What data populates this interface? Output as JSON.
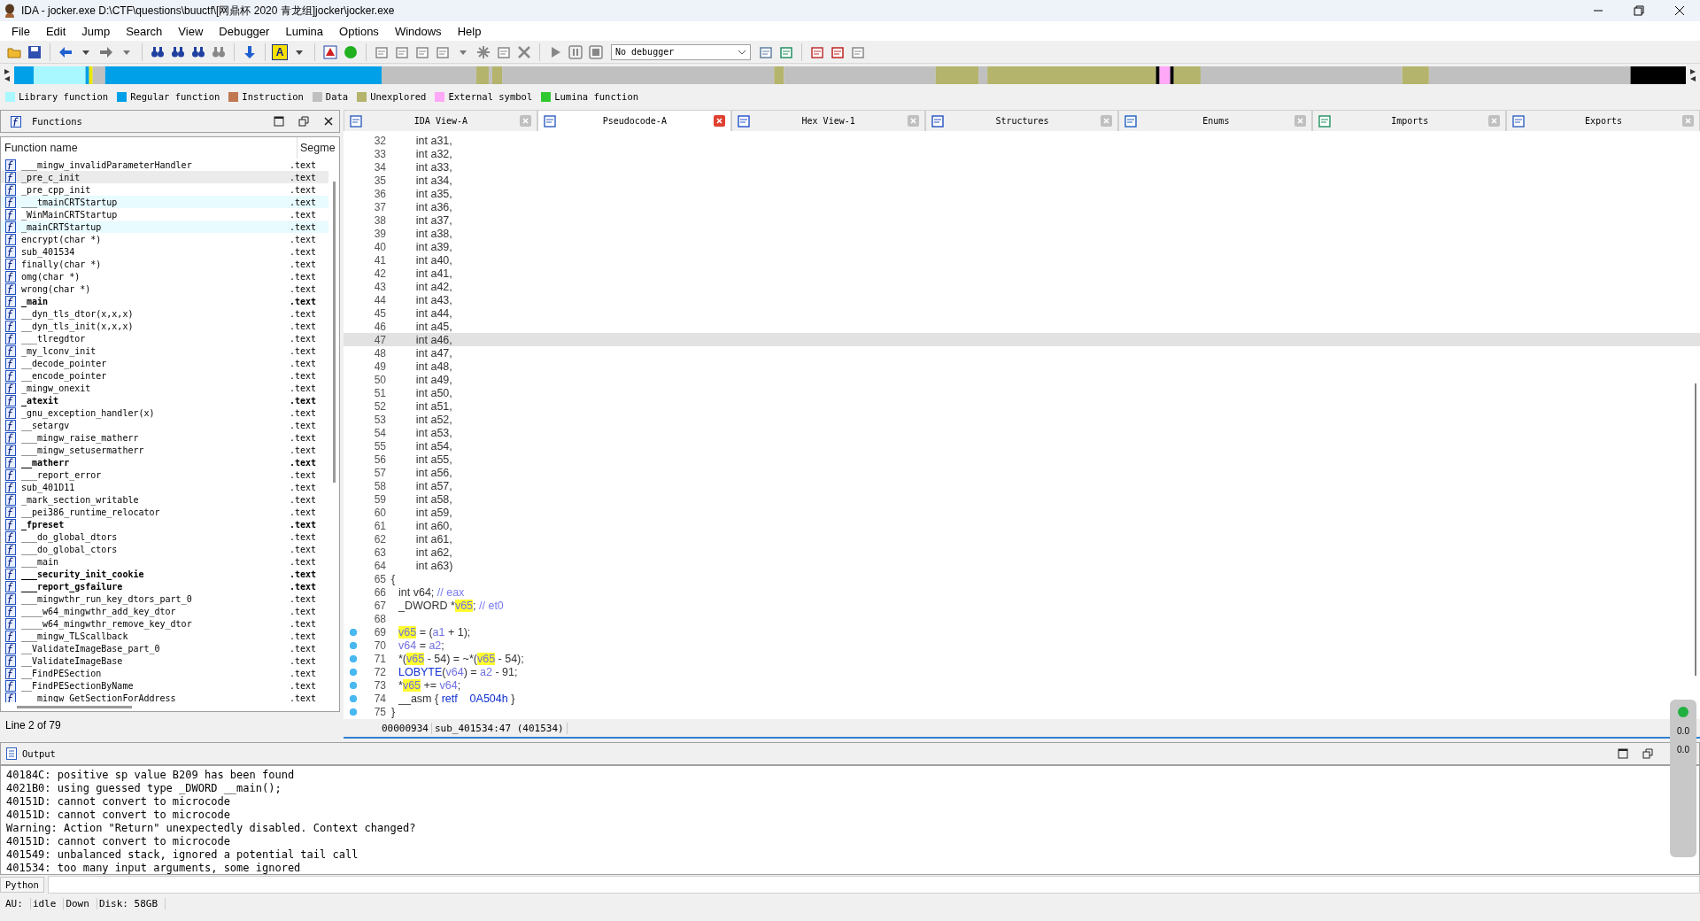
{
  "window": {
    "title": "IDA - jocker.exe D:\\CTF\\questions\\buuctf\\[网鼎杯 2020 青龙组]jocker\\jocker.exe"
  },
  "menu": [
    "File",
    "Edit",
    "Jump",
    "Search",
    "View",
    "Debugger",
    "Lumina",
    "Options",
    "Windows",
    "Help"
  ],
  "toolbar": {
    "font_button": "A",
    "debugger": "No debugger"
  },
  "legend": [
    {
      "label": "Library function",
      "color": "#aaf8ff"
    },
    {
      "label": "Regular function",
      "color": "#00a0e8"
    },
    {
      "label": "Instruction",
      "color": "#c07850"
    },
    {
      "label": "Data",
      "color": "#c0c0c0"
    },
    {
      "label": "Unexplored",
      "color": "#b4b46c"
    },
    {
      "label": "External symbol",
      "color": "#ffa8f8"
    },
    {
      "label": "Lumina function",
      "color": "#30c830"
    }
  ],
  "functions": {
    "title": "Functions",
    "columns": [
      "Function name",
      "Segme"
    ],
    "status": "Line 2 of 79",
    "rows": [
      {
        "name": "___mingw_invalidParameterHandler",
        "segment": ".text",
        "bold": false,
        "selected": false,
        "library": false
      },
      {
        "name": "_pre_c_init",
        "segment": ".text",
        "bold": false,
        "selected": true,
        "library": false
      },
      {
        "name": "_pre_cpp_init",
        "segment": ".text",
        "bold": false,
        "selected": false,
        "library": false
      },
      {
        "name": "___tmainCRTStartup",
        "segment": ".text",
        "bold": false,
        "selected": false,
        "library": true
      },
      {
        "name": "_WinMainCRTStartup",
        "segment": ".text",
        "bold": false,
        "selected": false,
        "library": false
      },
      {
        "name": "_mainCRTStartup",
        "segment": ".text",
        "bold": false,
        "selected": false,
        "library": true
      },
      {
        "name": "encrypt(char *)",
        "segment": ".text",
        "bold": false,
        "selected": false,
        "library": false
      },
      {
        "name": "sub_401534",
        "segment": ".text",
        "bold": false,
        "selected": false,
        "library": false
      },
      {
        "name": "finally(char *)",
        "segment": ".text",
        "bold": false,
        "selected": false,
        "library": false
      },
      {
        "name": "omg(char *)",
        "segment": ".text",
        "bold": false,
        "selected": false,
        "library": false
      },
      {
        "name": "wrong(char *)",
        "segment": ".text",
        "bold": false,
        "selected": false,
        "library": false
      },
      {
        "name": "_main",
        "segment": ".text",
        "bold": true,
        "selected": false,
        "library": false
      },
      {
        "name": "__dyn_tls_dtor(x,x,x)",
        "segment": ".text",
        "bold": false,
        "selected": false,
        "library": false
      },
      {
        "name": "__dyn_tls_init(x,x,x)",
        "segment": ".text",
        "bold": false,
        "selected": false,
        "library": false
      },
      {
        "name": "___tlregdtor",
        "segment": ".text",
        "bold": false,
        "selected": false,
        "library": false
      },
      {
        "name": "_my_lconv_init",
        "segment": ".text",
        "bold": false,
        "selected": false,
        "library": false
      },
      {
        "name": "__decode_pointer",
        "segment": ".text",
        "bold": false,
        "selected": false,
        "library": false
      },
      {
        "name": "__encode_pointer",
        "segment": ".text",
        "bold": false,
        "selected": false,
        "library": false
      },
      {
        "name": "_mingw_onexit",
        "segment": ".text",
        "bold": false,
        "selected": false,
        "library": false
      },
      {
        "name": "_atexit",
        "segment": ".text",
        "bold": true,
        "selected": false,
        "library": false
      },
      {
        "name": "_gnu_exception_handler(x)",
        "segment": ".text",
        "bold": false,
        "selected": false,
        "library": false
      },
      {
        "name": "__setargv",
        "segment": ".text",
        "bold": false,
        "selected": false,
        "library": false
      },
      {
        "name": "___mingw_raise_matherr",
        "segment": ".text",
        "bold": false,
        "selected": false,
        "library": false
      },
      {
        "name": "___mingw_setusermatherr",
        "segment": ".text",
        "bold": false,
        "selected": false,
        "library": false
      },
      {
        "name": "__matherr",
        "segment": ".text",
        "bold": true,
        "selected": false,
        "library": false
      },
      {
        "name": "___report_error",
        "segment": ".text",
        "bold": false,
        "selected": false,
        "library": false
      },
      {
        "name": "sub_401D11",
        "segment": ".text",
        "bold": false,
        "selected": false,
        "library": false
      },
      {
        "name": "_mark_section_writable",
        "segment": ".text",
        "bold": false,
        "selected": false,
        "library": false
      },
      {
        "name": "__pei386_runtime_relocator",
        "segment": ".text",
        "bold": false,
        "selected": false,
        "library": false
      },
      {
        "name": "_fpreset",
        "segment": ".text",
        "bold": true,
        "selected": false,
        "library": false
      },
      {
        "name": "___do_global_dtors",
        "segment": ".text",
        "bold": false,
        "selected": false,
        "library": false
      },
      {
        "name": "___do_global_ctors",
        "segment": ".text",
        "bold": false,
        "selected": false,
        "library": false
      },
      {
        "name": "___main",
        "segment": ".text",
        "bold": false,
        "selected": false,
        "library": false
      },
      {
        "name": "___security_init_cookie",
        "segment": ".text",
        "bold": true,
        "selected": false,
        "library": false
      },
      {
        "name": "___report_gsfailure",
        "segment": ".text",
        "bold": true,
        "selected": false,
        "library": false
      },
      {
        "name": "___mingwthr_run_key_dtors_part_0",
        "segment": ".text",
        "bold": false,
        "selected": false,
        "library": false
      },
      {
        "name": "____w64_mingwthr_add_key_dtor",
        "segment": ".text",
        "bold": false,
        "selected": false,
        "library": false
      },
      {
        "name": "____w64_mingwthr_remove_key_dtor",
        "segment": ".text",
        "bold": false,
        "selected": false,
        "library": false
      },
      {
        "name": "___mingw_TLScallback",
        "segment": ".text",
        "bold": false,
        "selected": false,
        "library": false
      },
      {
        "name": "__ValidateImageBase_part_0",
        "segment": ".text",
        "bold": false,
        "selected": false,
        "library": false
      },
      {
        "name": "__ValidateImageBase",
        "segment": ".text",
        "bold": false,
        "selected": false,
        "library": false
      },
      {
        "name": "__FindPESection",
        "segment": ".text",
        "bold": false,
        "selected": false,
        "library": false
      },
      {
        "name": "__FindPESectionByName",
        "segment": ".text",
        "bold": false,
        "selected": false,
        "library": false
      },
      {
        "name": "___mingw_GetSectionForAddress",
        "segment": ".text",
        "bold": false,
        "selected": false,
        "library": false
      }
    ]
  },
  "tabs": [
    {
      "label": "IDA View-A",
      "selected": false
    },
    {
      "label": "Pseudocode-A",
      "selected": true
    },
    {
      "label": "Hex View-1",
      "selected": false
    },
    {
      "label": "Structures",
      "selected": false
    },
    {
      "label": "Enums",
      "selected": false
    },
    {
      "label": "Imports",
      "selected": false
    },
    {
      "label": "Exports",
      "selected": false
    }
  ],
  "code": {
    "status": [
      "00000934",
      "sub_401534:47 (401534)"
    ],
    "lines": [
      {
        "number": "32",
        "dot": false,
        "selected": false,
        "block": false,
        "segments": [
          {
            "text": "        int a31,",
            "kind": "decl"
          }
        ]
      },
      {
        "number": "33",
        "dot": false,
        "selected": false,
        "block": false,
        "segments": [
          {
            "text": "        int a32,",
            "kind": "decl"
          }
        ]
      },
      {
        "number": "34",
        "dot": false,
        "selected": false,
        "block": false,
        "segments": [
          {
            "text": "        int a33,",
            "kind": "decl"
          }
        ]
      },
      {
        "number": "35",
        "dot": false,
        "selected": false,
        "block": false,
        "segments": [
          {
            "text": "        int a34,",
            "kind": "decl"
          }
        ]
      },
      {
        "number": "36",
        "dot": false,
        "selected": false,
        "block": false,
        "segments": [
          {
            "text": "        int a35,",
            "kind": "decl"
          }
        ]
      },
      {
        "number": "37",
        "dot": false,
        "selected": false,
        "block": false,
        "segments": [
          {
            "text": "        int a36,",
            "kind": "decl"
          }
        ]
      },
      {
        "number": "38",
        "dot": false,
        "selected": false,
        "block": false,
        "segments": [
          {
            "text": "        int a37,",
            "kind": "decl"
          }
        ]
      },
      {
        "number": "39",
        "dot": false,
        "selected": false,
        "block": false,
        "segments": [
          {
            "text": "        int a38,",
            "kind": "decl"
          }
        ]
      },
      {
        "number": "40",
        "dot": false,
        "selected": false,
        "block": false,
        "segments": [
          {
            "text": "        int a39,",
            "kind": "decl"
          }
        ]
      },
      {
        "number": "41",
        "dot": false,
        "selected": false,
        "block": false,
        "segments": [
          {
            "text": "        int a40,",
            "kind": "decl"
          }
        ]
      },
      {
        "number": "42",
        "dot": false,
        "selected": false,
        "block": false,
        "segments": [
          {
            "text": "        int a41,",
            "kind": "decl"
          }
        ]
      },
      {
        "number": "43",
        "dot": false,
        "selected": false,
        "block": false,
        "segments": [
          {
            "text": "        int a42,",
            "kind": "decl"
          }
        ]
      },
      {
        "number": "44",
        "dot": false,
        "selected": false,
        "block": false,
        "segments": [
          {
            "text": "        int a43,",
            "kind": "decl"
          }
        ]
      },
      {
        "number": "45",
        "dot": false,
        "selected": false,
        "block": false,
        "segments": [
          {
            "text": "        int a44,",
            "kind": "decl"
          }
        ]
      },
      {
        "number": "46",
        "dot": false,
        "selected": false,
        "block": false,
        "segments": [
          {
            "text": "        int a45,",
            "kind": "decl"
          }
        ]
      },
      {
        "number": "47",
        "dot": false,
        "selected": true,
        "block": false,
        "segments": [
          {
            "text": "        int a46,",
            "kind": "decl"
          }
        ]
      },
      {
        "number": "48",
        "dot": false,
        "selected": false,
        "block": false,
        "segments": [
          {
            "text": "        int a47,",
            "kind": "decl"
          }
        ]
      },
      {
        "number": "49",
        "dot": false,
        "selected": false,
        "block": false,
        "segments": [
          {
            "text": "        int a48,",
            "kind": "decl"
          }
        ]
      },
      {
        "number": "50",
        "dot": false,
        "selected": false,
        "block": false,
        "segments": [
          {
            "text": "        int a49,",
            "kind": "decl"
          }
        ]
      },
      {
        "number": "51",
        "dot": false,
        "selected": false,
        "block": false,
        "segments": [
          {
            "text": "        int a50,",
            "kind": "decl"
          }
        ]
      },
      {
        "number": "52",
        "dot": false,
        "selected": false,
        "block": false,
        "segments": [
          {
            "text": "        int a51,",
            "kind": "decl"
          }
        ]
      },
      {
        "number": "53",
        "dot": false,
        "selected": false,
        "block": false,
        "segments": [
          {
            "text": "        int a52,",
            "kind": "decl"
          }
        ]
      },
      {
        "number": "54",
        "dot": false,
        "selected": false,
        "block": false,
        "segments": [
          {
            "text": "        int a53,",
            "kind": "decl"
          }
        ]
      },
      {
        "number": "55",
        "dot": false,
        "selected": false,
        "block": false,
        "segments": [
          {
            "text": "        int a54,",
            "kind": "decl"
          }
        ]
      },
      {
        "number": "56",
        "dot": false,
        "selected": false,
        "block": false,
        "segments": [
          {
            "text": "        int a55,",
            "kind": "decl"
          }
        ]
      },
      {
        "number": "57",
        "dot": false,
        "selected": false,
        "block": false,
        "segments": [
          {
            "text": "        int a56,",
            "kind": "decl"
          }
        ]
      },
      {
        "number": "58",
        "dot": false,
        "selected": false,
        "block": false,
        "segments": [
          {
            "text": "        int a57,",
            "kind": "decl"
          }
        ]
      },
      {
        "number": "59",
        "dot": false,
        "selected": false,
        "block": false,
        "segments": [
          {
            "text": "        int a58,",
            "kind": "decl"
          }
        ]
      },
      {
        "number": "60",
        "dot": false,
        "selected": false,
        "block": false,
        "segments": [
          {
            "text": "        int a59,",
            "kind": "decl"
          }
        ]
      },
      {
        "number": "61",
        "dot": false,
        "selected": false,
        "block": false,
        "segments": [
          {
            "text": "        int a60,",
            "kind": "decl"
          }
        ]
      },
      {
        "number": "62",
        "dot": false,
        "selected": false,
        "block": false,
        "segments": [
          {
            "text": "        int a61,",
            "kind": "decl"
          }
        ]
      },
      {
        "number": "63",
        "dot": false,
        "selected": false,
        "block": false,
        "segments": [
          {
            "text": "        int a62,",
            "kind": "decl"
          }
        ]
      },
      {
        "number": "64",
        "dot": false,
        "selected": false,
        "block": false,
        "segments": [
          {
            "text": "        int a63)",
            "kind": "decl"
          }
        ]
      },
      {
        "number": "65",
        "dot": false,
        "selected": false,
        "block": false,
        "segments": [
          {
            "text": "{",
            "kind": "decl"
          }
        ]
      },
      {
        "number": "66",
        "dot": false,
        "selected": false,
        "block": true,
        "segments": [
          {
            "text": "int v64; ",
            "kind": "decl"
          },
          {
            "text": "// eax",
            "kind": "comment"
          }
        ]
      },
      {
        "number": "67",
        "dot": false,
        "selected": false,
        "block": true,
        "segments": [
          {
            "text": "_DWORD *",
            "kind": "decl"
          },
          {
            "text": "v65",
            "kind": "highlight"
          },
          {
            "text": "; ",
            "kind": "decl"
          },
          {
            "text": "// et0",
            "kind": "comment"
          }
        ]
      },
      {
        "number": "68",
        "dot": false,
        "selected": false
      },
      {
        "number": "69",
        "dot": true,
        "selected": false,
        "block": true,
        "segments": [
          {
            "text": "v65",
            "kind": "highlight"
          },
          {
            "text": " = (",
            "kind": "decl"
          },
          {
            "text": "a1",
            "kind": "var"
          },
          {
            "text": " + 1);",
            "kind": "decl"
          }
        ]
      },
      {
        "number": "70",
        "dot": true,
        "selected": false,
        "block": true,
        "segments": [
          {
            "text": "v64",
            "kind": "var"
          },
          {
            "text": " = ",
            "kind": "decl"
          },
          {
            "text": "a2",
            "kind": "var"
          },
          {
            "text": ";",
            "kind": "decl"
          }
        ]
      },
      {
        "number": "71",
        "dot": true,
        "selected": false,
        "block": true,
        "segments": [
          {
            "text": "*(",
            "kind": "decl"
          },
          {
            "text": "v65",
            "kind": "highlight"
          },
          {
            "text": " - 54) = ~*(",
            "kind": "decl"
          },
          {
            "text": "v65",
            "kind": "highlight"
          },
          {
            "text": " - 54);",
            "kind": "decl"
          }
        ]
      },
      {
        "number": "72",
        "dot": true,
        "selected": false,
        "block": true,
        "segments": [
          {
            "text": "LOBYTE",
            "kind": "macro"
          },
          {
            "text": "(",
            "kind": "decl"
          },
          {
            "text": "v64",
            "kind": "var"
          },
          {
            "text": ") = ",
            "kind": "decl"
          },
          {
            "text": "a2",
            "kind": "var"
          },
          {
            "text": " - 91;",
            "kind": "decl"
          }
        ]
      },
      {
        "number": "73",
        "dot": true,
        "selected": false,
        "block": true,
        "segments": [
          {
            "text": "*",
            "kind": "decl"
          },
          {
            "text": "v65",
            "kind": "highlight"
          },
          {
            "text": " += ",
            "kind": "decl"
          },
          {
            "text": "v64",
            "kind": "var"
          },
          {
            "text": ";",
            "kind": "decl"
          }
        ]
      },
      {
        "number": "74",
        "dot": true,
        "selected": false,
        "block": true,
        "segments": [
          {
            "text": "__asm { ",
            "kind": "decl"
          },
          {
            "text": "retf    0A504h",
            "kind": "macro"
          },
          {
            "text": " }",
            "kind": "decl"
          }
        ]
      },
      {
        "number": "75",
        "dot": true,
        "selected": false,
        "block": false,
        "segments": [
          {
            "text": "}",
            "kind": "decl"
          }
        ]
      }
    ]
  },
  "output": {
    "title": "Output",
    "input_tab": "Python",
    "lines": [
      "40184C: positive sp value B209 has been found",
      "4021B0: using guessed type _DWORD __main();",
      "40151D: cannot convert to microcode",
      "40151D: cannot convert to microcode",
      "Warning: Action \"Return\" unexpectedly disabled. Context changed?",
      "40151D: cannot convert to microcode",
      "401549: unbalanced stack, ignored a potential tail call",
      "401534: too many input arguments, some ignored"
    ]
  },
  "status_bar": [
    "AU:",
    "idle",
    "Down",
    "Disk: 58GB"
  ],
  "side_widget": [
    "0.0",
    "0.0"
  ]
}
